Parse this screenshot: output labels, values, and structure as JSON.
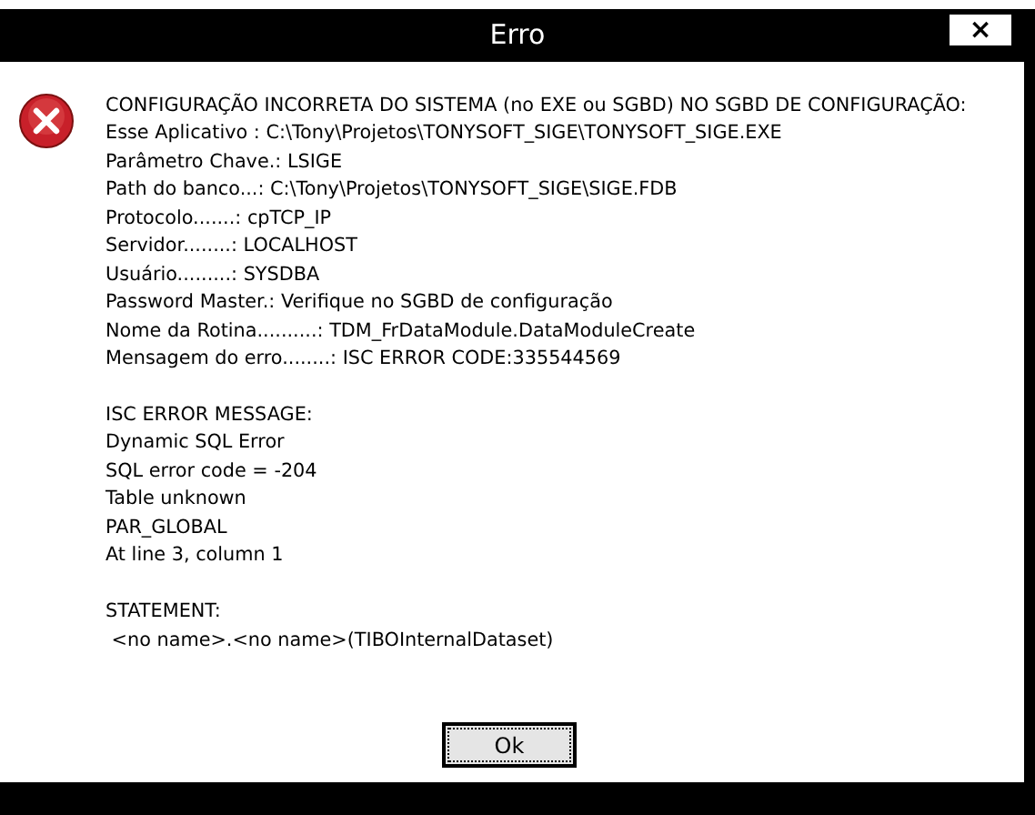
{
  "window": {
    "title": "Erro",
    "close": "×"
  },
  "message_sections": [
    {
      "lines": [
        "CONFIGURAÇÃO INCORRETA DO SISTEMA (no EXE ou SGBD) NO SGBD DE CONFIGURAÇÃO:",
        "Esse Aplicativo : C:\\Tony\\Projetos\\TONYSOFT_SIGE\\TONYSOFT_SIGE.EXE",
        "Parâmetro Chave.: LSIGE",
        "Path do banco...: C:\\Tony\\Projetos\\TONYSOFT_SIGE\\SIGE.FDB",
        "Protocolo.......: cpTCP_IP",
        "Servidor........: LOCALHOST",
        "Usuário.........: SYSDBA",
        "Password Master.: Verifique no SGBD de configuração",
        "Nome da Rotina..........: TDM_FrDataModule.DataModuleCreate",
        "Mensagem do erro........: ISC ERROR CODE:335544569"
      ]
    },
    {
      "lines": [
        "ISC ERROR MESSAGE:",
        "Dynamic SQL Error",
        "SQL error code = -204",
        "Table unknown",
        "PAR_GLOBAL",
        "At line 3, column 1"
      ]
    },
    {
      "lines": [
        "STATEMENT:",
        " <no name>.<no name>(TIBOInternalDataset)"
      ]
    }
  ],
  "buttons": [
    {
      "label": "Ok",
      "focused": true
    }
  ]
}
